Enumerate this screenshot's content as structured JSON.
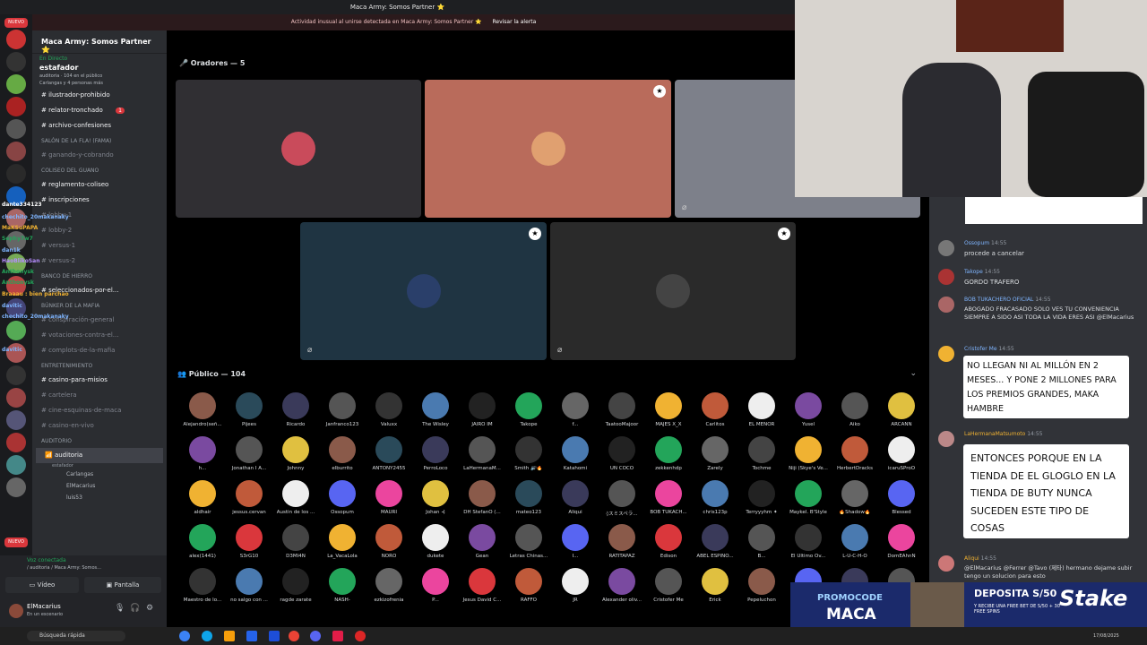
{
  "window": {
    "title": "Maca Army: Somos Partner ⭐"
  },
  "alert": {
    "text": "Actividad inusual al unirse detectada en Maca Army: Somos Partner ⭐",
    "action": "Revisar la alerta"
  },
  "rail": {
    "nuevo_label": "NUEVO"
  },
  "sidebar": {
    "server_name": "Maca Army: Somos Partner ⭐",
    "live": {
      "status": "En Directo",
      "name": "estafador",
      "info": "auditoria · 104 en el público",
      "sub": "Carlangas y 4 personas más"
    },
    "channels": [
      {
        "label": "ilustrador-prohibido",
        "white": true
      },
      {
        "label": "relator-tronchado",
        "white": true,
        "badge": "1"
      },
      {
        "label": "archivo-confesiones",
        "white": true
      }
    ],
    "cat1": "SALÓN DE LA FLA! (FAMA)",
    "cat1_items": [
      "ganando-y-cobrando"
    ],
    "cat2": "COLISEO DEL GUANO",
    "cat2_items": [
      "reglamento-coliseo",
      "inscripciones",
      "lobby-1",
      "lobby-2",
      "versus-1",
      "versus-2"
    ],
    "cat3": "BANCO DE HIERRO",
    "cat3_items": [
      "seleccionados-por-el..."
    ],
    "cat4": "BÚNKER DE LA MAFIA",
    "cat4_items": [
      "conspiración-general",
      "votaciones-contra-el...",
      "complots-de-la-mafia"
    ],
    "cat5": "ENTRETENIMIENTO",
    "cat5_items": [
      "casino-para-misios",
      "cartelera",
      "cine-esquinas-de-maca",
      "casino-en-vivo"
    ],
    "cat6": "AUDITORIO",
    "voice_channel": "auditoria",
    "voice_sub": "estafador",
    "voice_users": [
      "Carlangas",
      "ElMacarius",
      "luis53"
    ],
    "overlay_chat": [
      "dante334123",
      "chechito_20makanaky",
      "MaKSuPAPA",
      "Sephy7w7",
      "dan1k",
      "HaoBlikoSan",
      "Anthonysk",
      "Anthonysk",
      "Braaau : bien parchao",
      "davitic",
      "chechito_20makanaky",
      "davitic"
    ]
  },
  "voice_panel": {
    "status": "Voz conectada",
    "sub": "/ auditoria / Maca Army: Somos...",
    "video_label": "Vídeo",
    "screen_label": "Pantalla"
  },
  "user": {
    "name": "ElMacarius",
    "status": "En un escenario"
  },
  "stage": {
    "speakers_header": "Oradores — 5",
    "audience_header": "Público — 104"
  },
  "audience": [
    "Alejandro(señ...",
    "Pijees",
    "Ricardo",
    "Janfranco123",
    "Valuxx",
    "The Wisley",
    "JAIRO IM",
    "Takope",
    "f...",
    "TaatooMajoor",
    "MAJES X_X",
    "Carlitos",
    "EL MENOR",
    "Yusel",
    "Aiko",
    "ARCANN",
    "h...",
    "Jonathan I A...",
    "Johnny",
    "elburrito",
    "ANTONY2455",
    "PerroLoco",
    "LaHermanaM...",
    "Smith 🔊🔥",
    "Katahomi",
    "UN COCO",
    "zekkenhdp",
    "Zarely",
    "Tochme",
    "Niji (Skye's Ve...",
    "HerbertDracks",
    "icaruSProO",
    "aldhair",
    "jessus.cervan",
    "Austin de los ...",
    "Ossopum",
    "MAURI",
    "Johan ⊰",
    "DH StefanO (...",
    "mateo123",
    "Aliqui",
    "◊スミスペラ...",
    "BOB TUKACH...",
    "chris123p",
    "Terryyyhm ✦",
    "Maykel. B'Style",
    "🔥Shadow🔥",
    "Blessed",
    "alex(1441)",
    "S3rG10",
    "D3MI4N",
    "La_VacaLola",
    "NORO",
    "dukete",
    "Gean",
    "Letras Chinas...",
    "I...",
    "RATITAPAZ",
    "Edison",
    "ABEL ESPINO...",
    "B...",
    "El Ultimo Ov...",
    "L-U-C-H-O",
    "DomEAhnN",
    "Maestro de lo...",
    "no salgo con ...",
    "ragde zarate",
    "NASH-",
    "ezkizofrenia",
    "P...",
    "Jesus David C...",
    "RAFFO",
    "JR",
    "Alexander oliv...",
    "Cristofer Me",
    "Erick",
    "Pepeluchon",
    "",
    "",
    ""
  ],
  "chat": [
    {
      "user": "Ossopum",
      "time": "14:55",
      "text": "procede a cancelar",
      "color": "#7fb5ff"
    },
    {
      "user": "Takope",
      "time": "14:55",
      "text": "GORDO TRAFERO",
      "color": "#7fb5ff"
    },
    {
      "user": "BOB TUKACHERO OFICIAL",
      "time": "14:55",
      "text": "ABOGADO FRACASADO SOLO VES TU CONVENIENCIA SIEMPRE A SIDO ASI TODA LA VIDA ERES ASI @ElMacarius",
      "color": "#7fb5ff"
    },
    {
      "user": "Cristofer Me",
      "time": "14:55",
      "text": "",
      "color": "#7fb5ff"
    },
    {
      "user": "LaHermanaMatsumoto",
      "time": "14:55",
      "text": "",
      "color": "#f0b232"
    },
    {
      "user": "Aliqui",
      "time": "14:55",
      "text": "@ElMacarius @Ferrer @Tavo (제타) hermano dejame subir tengo un solucion para esto",
      "color": "#f0b232"
    }
  ],
  "bubble1": "NO LLEGAN NI AL MILLÓN EN 2 MESES... Y PONE 2 MILLONES PARA LOS PREMIOS GRANDES, MAKA HAMBRE",
  "bubble2": "ENTONCES PORQUE EN LA TIENDA DE EL GLOGLO EN LA TIENDA DE BUTY NUNCA SUCEDEN ESTE TIPO DE COSAS",
  "promo": {
    "code_label": "PROMOCODE",
    "code": "MACA",
    "deposit": "DEPOSITA S/50",
    "offer": "Y RECIBE UNA FREE BET DE S/50 + 30 FREE SPINS",
    "brand": "Stake"
  },
  "taskbar": {
    "search": "Búsqueda rápida",
    "date": "17/08/2025"
  },
  "colors": {
    "accent": "#5865f2",
    "danger": "#da373c",
    "online": "#23a55a"
  }
}
